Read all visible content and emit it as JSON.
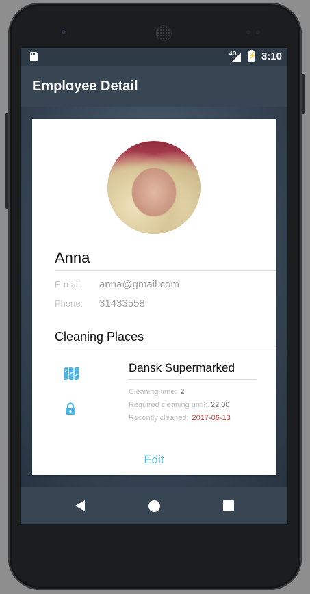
{
  "status_bar": {
    "network": "4G",
    "time": "3:10"
  },
  "app_bar": {
    "title": "Employee Detail"
  },
  "employee": {
    "name": "Anna",
    "email_label": "E-mail:",
    "email": "anna@gmail.com",
    "phone_label": "Phone:",
    "phone": "31433558"
  },
  "cleaning_places": {
    "section_title": "Cleaning Places",
    "items": [
      {
        "name": "Dansk Supermarked",
        "cleaning_time_label": "Cleaning time:",
        "cleaning_time": "2",
        "required_until_label": "Required cleaning until:",
        "required_until": "22:00",
        "recently_cleaned_label": "Recently cleaned:",
        "recently_cleaned": "2017-06-13"
      }
    ]
  },
  "actions": {
    "edit_label": "Edit"
  },
  "icons": {
    "map": "map-icon",
    "lock": "lock-icon",
    "back": "back-icon",
    "home": "home-icon",
    "recent": "recent-apps-icon"
  },
  "colors": {
    "accent": "#5ac1df",
    "icon_blue": "#4fb3df",
    "app_bar": "#384653",
    "date_red": "#e53935"
  }
}
